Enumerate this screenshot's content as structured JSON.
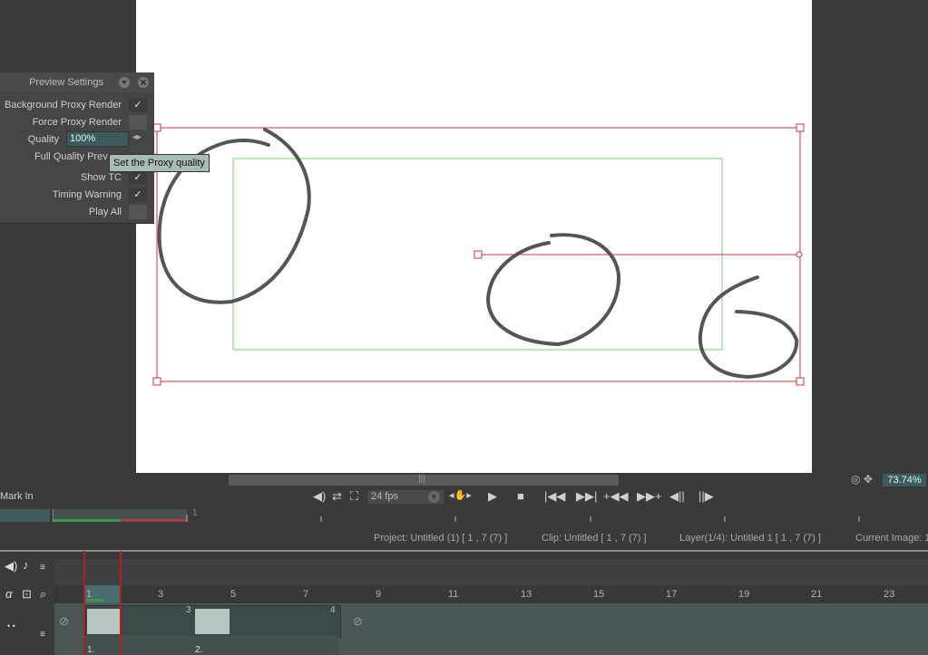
{
  "panel": {
    "title": "Preview Settings",
    "rows": [
      {
        "label": "Background Proxy Render",
        "checked": true
      },
      {
        "label": "Force Proxy Render",
        "checked": false
      },
      {
        "label": "Quality",
        "value": "100%"
      },
      {
        "label": "Full Quality Prev",
        "checked": false
      },
      {
        "label": "Show TC",
        "checked": true
      },
      {
        "label": "Timing Warning",
        "checked": true
      },
      {
        "label": "Play All",
        "checked": false
      }
    ]
  },
  "tooltip": "Set the Proxy quality",
  "zoom": "73.74%",
  "transport": {
    "mark_in": "Mark In",
    "fps": "24 fps"
  },
  "ruler_top": {
    "label": "1"
  },
  "info": {
    "project": "Project: Untitled (1) [ 1 , 7  (7) ]",
    "clip": "Clip: Untitled [ 1 , 7  (7) ]",
    "layer": "Layer(1/4): Untitled 1 [ 1 , 7  (7) ]",
    "current": "Current Image: 1"
  },
  "timeline": {
    "frame_numbers": [
      "1",
      "3",
      "5",
      "7",
      "9",
      "11",
      "13",
      "15",
      "17",
      "19",
      "21",
      "23"
    ],
    "clip_labels": [
      "1.",
      "2."
    ],
    "cel_marks": [
      "3",
      "4"
    ]
  },
  "colors": {
    "accent": "#3e5a5a",
    "bounds": "#d03040",
    "safe": "#6fdc6f"
  }
}
